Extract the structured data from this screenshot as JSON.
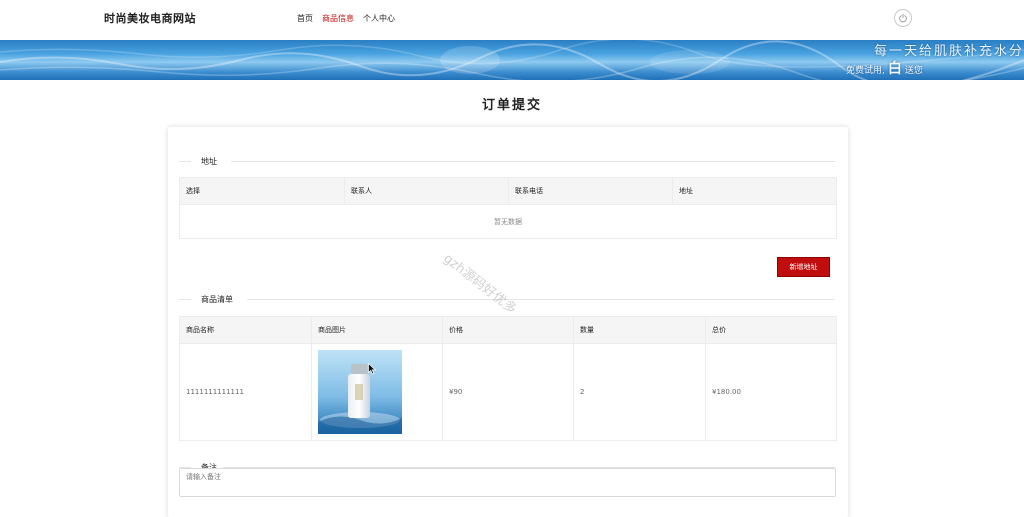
{
  "header": {
    "site_title": "时尚美妆电商网站",
    "nav": [
      {
        "label": "首页",
        "active": false
      },
      {
        "label": "商品信息",
        "active": true
      },
      {
        "label": "个人中心",
        "active": false
      }
    ],
    "power_icon": "power-icon"
  },
  "banner": {
    "line1": "每一天给肌肤补充水分",
    "line2_prefix": "免费试用,",
    "line2_big": "白",
    "line2_suffix": "送您"
  },
  "page": {
    "title": "订单提交"
  },
  "address_section": {
    "title": "地址",
    "columns": [
      "选择",
      "联系人",
      "联系电话",
      "地址"
    ],
    "empty_text": "暂无数据",
    "add_button": "新增地址"
  },
  "products_section": {
    "title": "商品清单",
    "columns": [
      "商品名称",
      "商品图片",
      "价格",
      "数量",
      "总价"
    ],
    "rows": [
      {
        "name": "1111111111111",
        "image": "product-bottle-image",
        "price": "¥90",
        "quantity": "2",
        "total": "¥180.00"
      }
    ]
  },
  "remark_section": {
    "title": "备注",
    "placeholder": "请输入备注"
  },
  "watermark": "gzh源码好优多",
  "colors": {
    "accent_red": "#c00d0d",
    "nav_active": "#c50f0f",
    "banner_blue": "#2a7fc4"
  }
}
